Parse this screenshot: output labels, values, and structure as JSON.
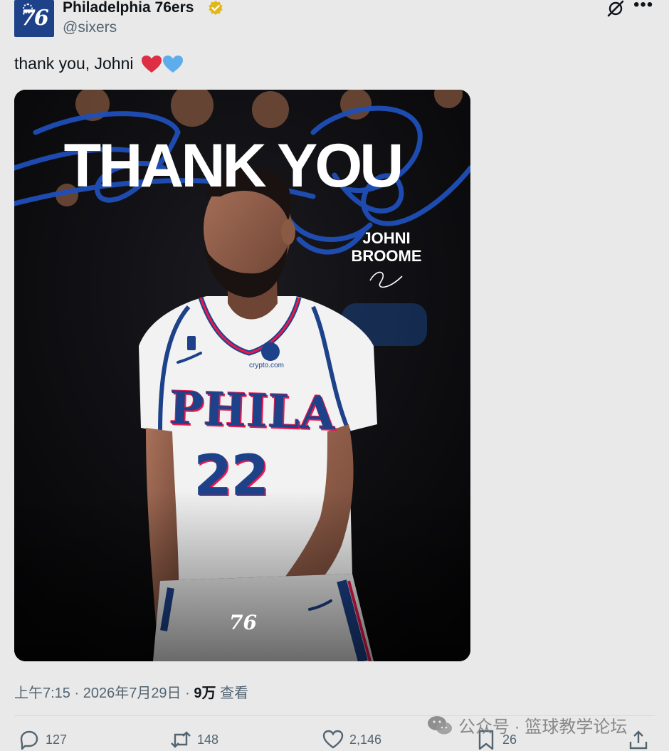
{
  "account": {
    "display_name": "Philadelphia 76ers",
    "handle": "@sixers",
    "avatar_text": "76",
    "verified_badge": "gold-checkmark"
  },
  "tweet": {
    "text": "thank you, Johni",
    "emojis": [
      "red-heart",
      "blue-heart"
    ]
  },
  "media": {
    "headline": "THANK YOU",
    "script_overlay": "Thank You",
    "player_first": "JOHNI",
    "player_last": "BROOME",
    "jersey_word": "PHILA",
    "jersey_number": "22",
    "sponsor": "crypto.com",
    "logo": "76"
  },
  "meta": {
    "time_date": "上午7:15 · 2026年7月29日 · ",
    "views_count": "9万",
    "views_label": " 查看"
  },
  "actions": {
    "replies": "127",
    "retweets": "148",
    "likes": "2,146",
    "bookmarks": "26"
  },
  "watermark": {
    "text": "公众号 · 篮球教学论坛"
  },
  "colors": {
    "background": "#e9e9e9",
    "brand_blue": "#1d428a",
    "brand_red": "#ed174c",
    "text_secondary": "#536471"
  }
}
